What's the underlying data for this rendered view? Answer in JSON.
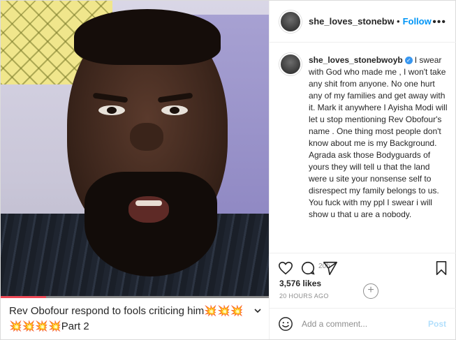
{
  "media": {
    "caption": "Rev Obofour respond to fools criticing him💥💥💥💥💥💥💥Part 2",
    "progress_fraction": 0.17
  },
  "header": {
    "username": "she_loves_stonebwoyb",
    "separator": "•",
    "follow_label": "Follow",
    "more_label": "•••"
  },
  "post": {
    "username": "she_loves_stonebwoyb",
    "text": "I swear with God who made me , I won't take any shit from anyone. No one hurt any of my families and get away with it. Mark it anywhere I Ayisha Modi will let u stop mentioning Rev Obofour's name . One thing most people don't know about me is my Background. Agrada ask those Bodyguards of yours they will tell u that the land were u site your nonsense self to disrespect my family belongs to us. You fuck with my ppl I swear i will show u that u are a nobody.",
    "time": "20h"
  },
  "stats": {
    "likes": "3,576 likes",
    "ago": "20 HOURS AGO"
  },
  "comment_box": {
    "placeholder": "Add a comment...",
    "post_label": "Post"
  },
  "icons": [
    "heart-icon",
    "comment-icon",
    "share-icon",
    "bookmark-icon",
    "emoji-icon",
    "add-icon",
    "verified-icon",
    "more-icon"
  ],
  "colors": {
    "accent": "#0095f6",
    "progress": "#ed4956"
  }
}
